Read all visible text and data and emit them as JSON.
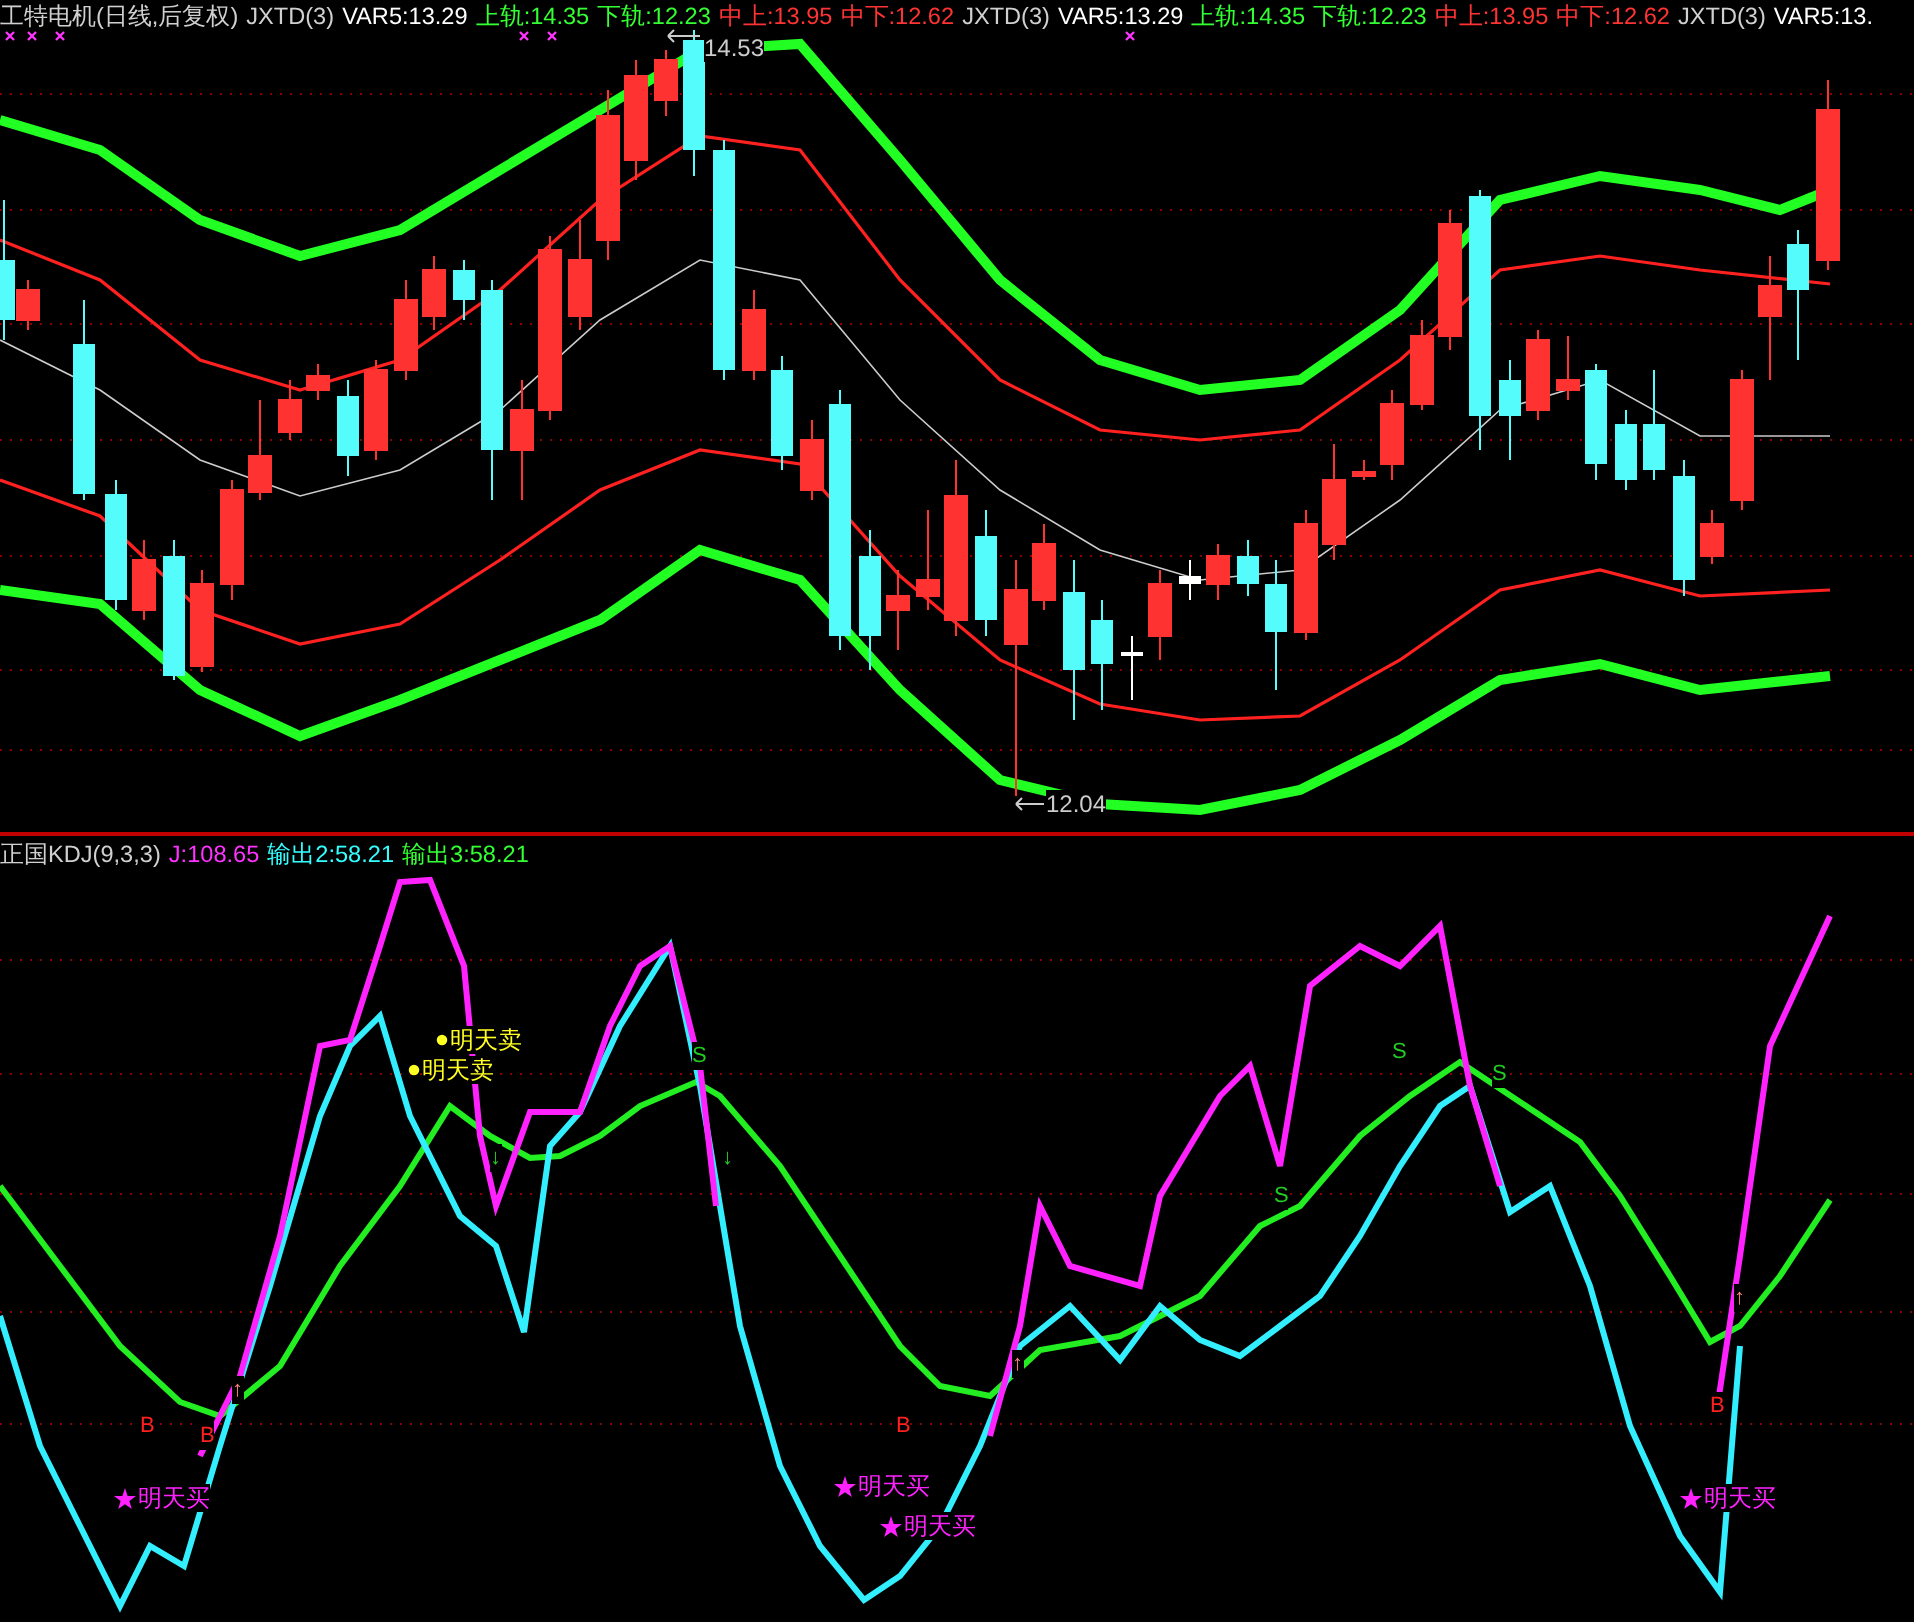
{
  "price_panel": {
    "legend": [
      {
        "text": "工特电机(日线,后复权)",
        "color": "#d0d0d0"
      },
      {
        "text": "JXTD(3)",
        "color": "#d0d0d0"
      },
      {
        "text": "VAR5:13.29",
        "color": "#ffffff"
      },
      {
        "text": "上轨:14.35",
        "color": "#33ff33"
      },
      {
        "text": "下轨:12.23",
        "color": "#33ff33"
      },
      {
        "text": "中上:13.95",
        "color": "#ff3333"
      },
      {
        "text": "中下:12.62",
        "color": "#ff3333"
      },
      {
        "text": "JXTD(3)",
        "color": "#d0d0d0"
      },
      {
        "text": "VAR5:13.29",
        "color": "#ffffff"
      },
      {
        "text": "上轨:14.35",
        "color": "#33ff33"
      },
      {
        "text": "下轨:12.23",
        "color": "#33ff33"
      },
      {
        "text": "中上:13.95",
        "color": "#ff3333"
      },
      {
        "text": "中下:12.62",
        "color": "#ff3333"
      },
      {
        "text": "JXTD(3)",
        "color": "#d0d0d0"
      },
      {
        "text": "VAR5:13.",
        "color": "#ffffff"
      }
    ],
    "high_label": "14.53",
    "low_label": "12.04"
  },
  "indicator_panel": {
    "legend": [
      {
        "text": "正国KDJ(9,3,3)",
        "color": "#d0d0d0"
      },
      {
        "text": "J:108.65",
        "color": "#ff33ff"
      },
      {
        "text": "输出2:58.21",
        "color": "#33ffff"
      },
      {
        "text": "输出3:58.21",
        "color": "#33ff33"
      }
    ],
    "markers": [
      {
        "kind": "buy",
        "text": "明天买"
      },
      {
        "kind": "buy",
        "text": "明天买"
      },
      {
        "kind": "buy",
        "text": "明天买"
      },
      {
        "kind": "buy",
        "text": "明天买"
      },
      {
        "kind": "sell",
        "text": "明天卖"
      },
      {
        "kind": "sell",
        "text": "明天卖"
      },
      {
        "kind": "b",
        "text": "B"
      },
      {
        "kind": "b",
        "text": "B"
      },
      {
        "kind": "b",
        "text": "B"
      },
      {
        "kind": "b",
        "text": "B"
      },
      {
        "kind": "s",
        "text": "S"
      },
      {
        "kind": "s",
        "text": "S"
      },
      {
        "kind": "s",
        "text": "S"
      },
      {
        "kind": "s",
        "text": "S"
      },
      {
        "kind": "up",
        "text": "↑"
      },
      {
        "kind": "up",
        "text": "↑"
      },
      {
        "kind": "up",
        "text": "↑"
      },
      {
        "kind": "down",
        "text": "↓"
      },
      {
        "kind": "down",
        "text": "↓"
      }
    ]
  }
}
